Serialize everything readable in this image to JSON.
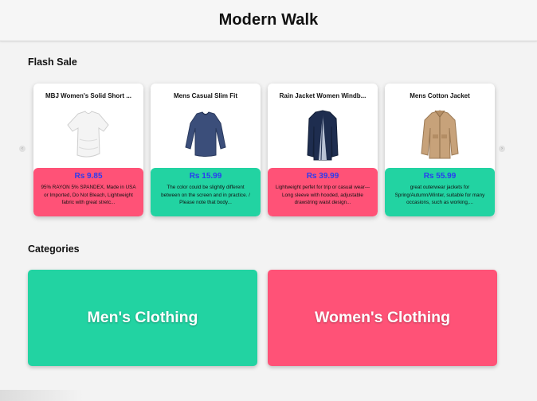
{
  "header": {
    "title": "Modern Walk"
  },
  "flash_sale": {
    "title": "Flash Sale",
    "products": [
      {
        "title": "MBJ Women's Solid Short ...",
        "price": "Rs 9.85",
        "description": "95% RAYON 5% SPANDEX, Made in USA or Imported, Do Not Bleach, Lightweight fabric with great stretc...",
        "color": "#ff5277",
        "icon": "white-tshirt-image"
      },
      {
        "title": "Mens Casual Slim Fit",
        "price": "Rs 15.99",
        "description": "The color could be slightly different between on the screen and in practice. / Please note that body...",
        "color": "#22d3a2",
        "icon": "navy-longsleeve-image"
      },
      {
        "title": "Rain Jacket Women Windb...",
        "price": "Rs 39.99",
        "description": "Lightweight perfet for trip or casual wear---Long sleeve with hooded, adjustable drawstring waist design...",
        "color": "#ff5277",
        "icon": "navy-raincoat-image"
      },
      {
        "title": "Mens Cotton Jacket",
        "price": "Rs 55.99",
        "description": "great outerwear jackets for Spring/Autumn/Winter, suitable for many occasions, such as working,...",
        "color": "#22d3a2",
        "icon": "khaki-jacket-image"
      }
    ]
  },
  "categories": {
    "title": "Categories",
    "items": [
      {
        "label": "Men's Clothing",
        "color": "#22d3a2"
      },
      {
        "label": "Women's Clothing",
        "color": "#ff5277"
      }
    ]
  }
}
